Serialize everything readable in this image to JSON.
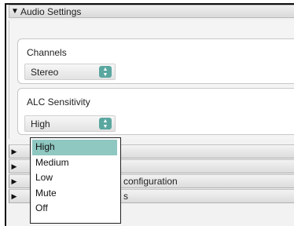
{
  "audio_settings": {
    "header_label": "Audio Settings",
    "expanded": true,
    "channels": {
      "label": "Channels",
      "selected": "Stereo"
    },
    "alc_sensitivity": {
      "label": "ALC Sensitivity",
      "selected": "High",
      "options": [
        "High",
        "Medium",
        "Low",
        "Mute",
        "Off"
      ],
      "highlighted_option": "High"
    }
  },
  "collapsed_sections": [
    {
      "label": ""
    },
    {
      "label": ""
    },
    {
      "label": "configuration"
    },
    {
      "label": "s"
    }
  ],
  "colors": {
    "accent": "#5aa7a0",
    "highlight": "#8fc7c1"
  },
  "icons": {
    "expanded_arrow": "triangle-down-icon",
    "collapsed_arrow": "triangle-right-icon",
    "select_spin": "up-down-arrows-icon"
  }
}
